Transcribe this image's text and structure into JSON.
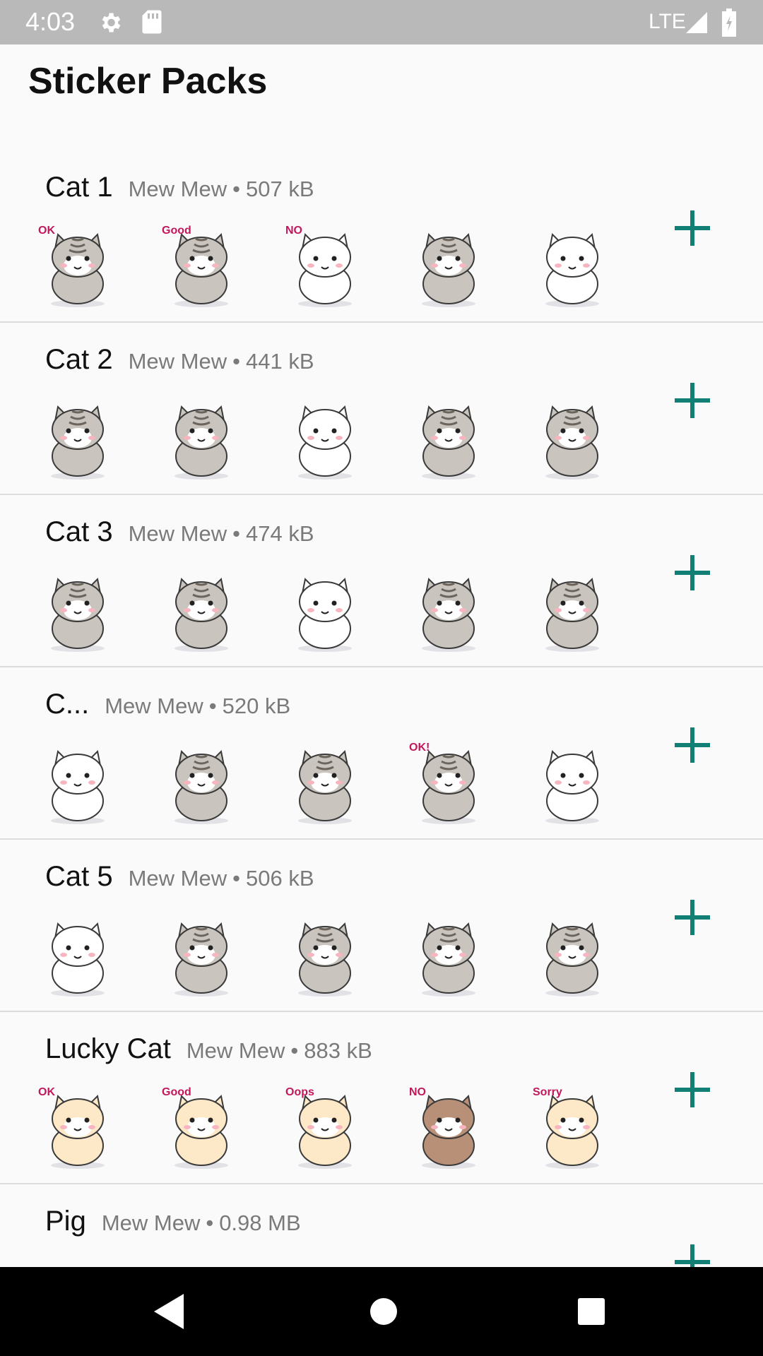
{
  "status_bar": {
    "time": "4:03",
    "network": "LTE"
  },
  "header": {
    "title": "Sticker Packs"
  },
  "packs": [
    {
      "name": "Cat 1",
      "publisher": "Mew Mew",
      "separator": "•",
      "size": "507 kB",
      "stickers": [
        {
          "label": "OK",
          "body": "#c9c4bd"
        },
        {
          "label": "Good",
          "body": "#c9c4bd"
        },
        {
          "label": "NO",
          "body": "#ffffff"
        },
        {
          "label": "",
          "body": "#c9c4bd"
        },
        {
          "label": "",
          "body": "#ffffff"
        }
      ]
    },
    {
      "name": "Cat 2",
      "publisher": "Mew Mew",
      "separator": "•",
      "size": "441 kB",
      "stickers": [
        {
          "label": "",
          "body": "#c9c4bd"
        },
        {
          "label": "",
          "body": "#c9c4bd"
        },
        {
          "label": "",
          "body": "#ffffff"
        },
        {
          "label": "",
          "body": "#c9c4bd"
        },
        {
          "label": "",
          "body": "#c9c4bd"
        }
      ]
    },
    {
      "name": "Cat 3",
      "publisher": "Mew Mew",
      "separator": "•",
      "size": "474 kB",
      "stickers": [
        {
          "label": "",
          "body": "#c9c4bd"
        },
        {
          "label": "",
          "body": "#c9c4bd"
        },
        {
          "label": "",
          "body": "#ffffff"
        },
        {
          "label": "",
          "body": "#c9c4bd"
        },
        {
          "label": "",
          "body": "#c9c4bd"
        }
      ]
    },
    {
      "name": "C...",
      "publisher": "Mew Mew",
      "separator": "•",
      "size": "520 kB",
      "stickers": [
        {
          "label": "",
          "body": "#ffffff"
        },
        {
          "label": "",
          "body": "#c9c4bd"
        },
        {
          "label": "",
          "body": "#c9c4bd"
        },
        {
          "label": "OK!",
          "body": "#c9c4bd"
        },
        {
          "label": "",
          "body": "#ffffff"
        }
      ]
    },
    {
      "name": "Cat 5",
      "publisher": "Mew Mew",
      "separator": "•",
      "size": "506 kB",
      "stickers": [
        {
          "label": "",
          "body": "#ffffff"
        },
        {
          "label": "",
          "body": "#c9c4bd"
        },
        {
          "label": "",
          "body": "#c9c4bd"
        },
        {
          "label": "",
          "body": "#c9c4bd"
        },
        {
          "label": "",
          "body": "#c9c4bd"
        }
      ]
    },
    {
      "name": "Lucky Cat",
      "publisher": "Mew Mew",
      "separator": "•",
      "size": "883 kB",
      "stickers": [
        {
          "label": "OK",
          "body": "#fde8c7"
        },
        {
          "label": "Good",
          "body": "#fde8c7"
        },
        {
          "label": "Oops",
          "body": "#fde8c7"
        },
        {
          "label": "NO",
          "body": "#b89078"
        },
        {
          "label": "Sorry",
          "body": "#fde8c7"
        }
      ]
    },
    {
      "name": "Pig",
      "publisher": "Mew Mew",
      "separator": "•",
      "size": "0.98 MB",
      "stickers": []
    }
  ],
  "colors": {
    "accent": "#117f74",
    "status_bar": "#b9b9b9",
    "nav_bar": "#000000",
    "divider": "#dcdcdc"
  },
  "icons": {
    "status": [
      "gear-icon",
      "sd-card-icon",
      "signal-icon",
      "battery-icon"
    ],
    "add": "plus-icon",
    "nav": [
      "back-icon",
      "home-icon",
      "recents-icon"
    ]
  }
}
